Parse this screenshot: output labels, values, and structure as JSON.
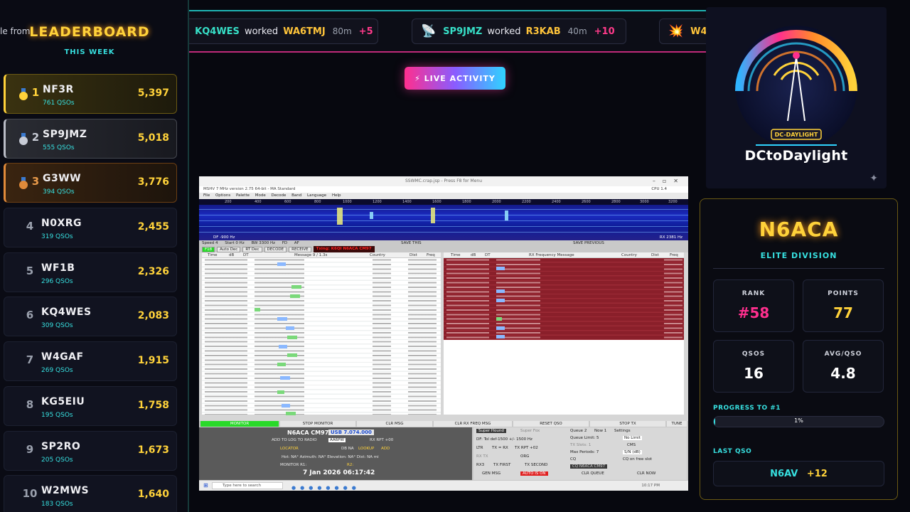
{
  "leaderboard": {
    "ghost_text": "le from",
    "title": "LEADERBOARD",
    "subtitle": "THIS WEEK",
    "rows": [
      {
        "rank": "1",
        "call": "NF3R",
        "qsos": "761 QSOs",
        "points": "5,397"
      },
      {
        "rank": "2",
        "call": "SP9JMZ",
        "qsos": "555 QSOs",
        "points": "5,018"
      },
      {
        "rank": "3",
        "call": "G3WW",
        "qsos": "394 QSOs",
        "points": "3,776"
      },
      {
        "rank": "4",
        "call": "N0XRG",
        "qsos": "319 QSOs",
        "points": "2,455"
      },
      {
        "rank": "5",
        "call": "WF1B",
        "qsos": "296 QSOs",
        "points": "2,326"
      },
      {
        "rank": "6",
        "call": "KQ4WES",
        "qsos": "309 QSOs",
        "points": "2,083"
      },
      {
        "rank": "7",
        "call": "W4GAF",
        "qsos": "269 QSOs",
        "points": "1,915"
      },
      {
        "rank": "8",
        "call": "KG5EIU",
        "qsos": "195 QSOs",
        "points": "1,758"
      },
      {
        "rank": "9",
        "call": "SP2RO",
        "qsos": "205 QSOs",
        "points": "1,673"
      },
      {
        "rank": "10",
        "call": "W2MWS",
        "qsos": "183 QSOs",
        "points": "1,640"
      }
    ]
  },
  "ticker": [
    {
      "icon": "📡",
      "call1": "KQ4WES",
      "worked": "worked",
      "call2": "WA6TMJ",
      "band": "80m",
      "points": "+5"
    },
    {
      "icon": "📡",
      "call1": "SP9JMZ",
      "worked": "worked",
      "call2": "R3KAB",
      "band": "40m",
      "points": "+10"
    },
    {
      "icon": "💥",
      "call1": "W4",
      "worked": "",
      "call2": "",
      "band": "",
      "points": ""
    }
  ],
  "live_button": "⚡ LIVE ACTIVITY",
  "logo": {
    "text": "DCtoDaylight",
    "badge": "DC-DAYLIGHT",
    "spark": "✦"
  },
  "stats": {
    "callsign": "N6ACA",
    "division": "ELITE DIVISION",
    "rank_label": "RANK",
    "rank": "#58",
    "points_label": "POINTS",
    "points": "77",
    "qsos_label": "QSOS",
    "qsos": "16",
    "avg_label": "AVG/QSO",
    "avg": "4.8",
    "progress_label": "PROGRESS TO #1",
    "progress_text": "1%",
    "progress_pct": 1,
    "last_label": "LAST QSO",
    "last_call": "N6AV",
    "last_points": "+12",
    "colors": {
      "rank": "#ff2f8e",
      "points": "#ffd23a",
      "qsos": "#ffffff",
      "avg": "#ffffff"
    }
  },
  "window": {
    "title": "SSWMC.crap.jsp - Press F8 for Menu",
    "caption": "MSHV 7 MHz version 2.75 64-bit - MA Standard",
    "cpu": "CPU 1.4",
    "menu": [
      "File",
      "Options",
      "Palette",
      "Mode",
      "Decode",
      "Band",
      "Language",
      "Help"
    ],
    "scale": [
      "200",
      "400",
      "600",
      "800",
      "1000",
      "1200",
      "1400",
      "1600",
      "1800",
      "2000",
      "2200",
      "2400",
      "2600",
      "2800",
      "3000",
      "3200"
    ],
    "df": "DF -900 Hz",
    "rx": "RX 2381 Hz",
    "bar1": [
      "Speed 4",
      "Start 0 Hz",
      "BW 3300 Hz",
      "FD",
      "AF",
      "SAVE THIS",
      "SAVE PREVIOUS"
    ],
    "bar2_buttons": [
      "F18",
      "Auto Dec",
      "RT Dec",
      "DECODE",
      "RECEIVE"
    ],
    "txing": "Txing: K6QI N6ACA CM97",
    "left_headers": [
      "Time",
      "dB",
      "DT",
      "Message 9 / 1.3s",
      "Country",
      "Dist",
      "Freq"
    ],
    "right_headers": [
      "Time",
      "dB",
      "DT",
      "RX Frequency Message",
      "Country",
      "Dist",
      "Freq"
    ],
    "bottom_buttons": [
      "MONITOR",
      "STOP MONITOR",
      "CLR MSG",
      "CLR RX FREQ MSG",
      "RESET QSO",
      "STOP TX",
      "TUNE"
    ],
    "my_call": "N6ACA CM97",
    "usb_freq": "USB 7.074.000",
    "add_log": "ADD TO LOG TO RADIO",
    "his_call": "AA6PW",
    "rx_rpt": "RX RPT +00",
    "locator": "LOCATOR",
    "db_na": "DB NA",
    "lookup": "LOOKUP",
    "add": "ADD",
    "hot": "Hot: NA° Azimuth: NA° Elevation: NA° Dist: NA mi",
    "monitor_r": "MONITOR R1:",
    "r2": "R2:",
    "datetime": "7 Jan 2026  06:17:42",
    "rp": {
      "super_hound": "Super Hound",
      "super_fox": "Super Fox",
      "df_line": "DF: Tol def-1500 +/- 1500 Hz",
      "ltr": "LTR",
      "txrx": "TX = RX",
      "tx_rpt": "TX RPT +02",
      "rx_tx": "RX TX",
      "org": "ORG",
      "rx3": "RX3",
      "tx_first": "TX FIRST",
      "tx_second": "TX SECOND",
      "gen_msg": "GEN MSG",
      "auto_on": "AUTO IS ON",
      "queue": "Queue 2",
      "now": "Now 1",
      "settings": "Settings",
      "queue_limit": "Queue Limit: 5",
      "no_limit": "No Limit",
      "tx_slots": "TX Slots: 1",
      "cms": "CMS",
      "max_periods": "Max Periods: 7",
      "sn_db": "S/N (dB)",
      "cq": "CQ",
      "cq_free": "CQ on free slot",
      "cq_msg": "CQ N6ACA CM97",
      "clr_queue": "CLR QUEUE",
      "clr_now": "CLR NOW"
    },
    "taskbar": {
      "search": "Type here to search",
      "clock": "10:17 PM"
    }
  }
}
